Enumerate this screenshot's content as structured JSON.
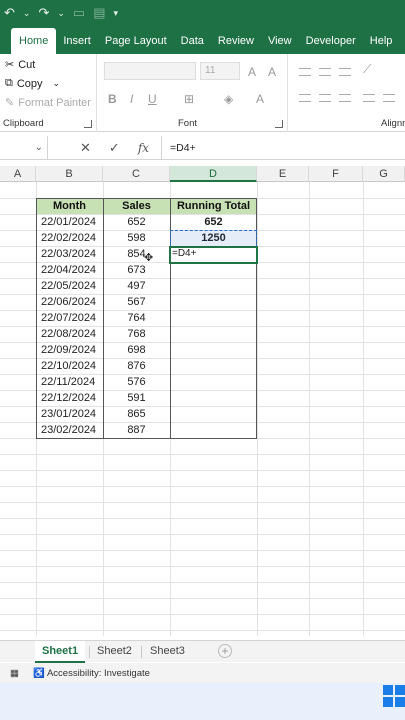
{
  "ribbon_tabs": [
    "Home",
    "Insert",
    "Page Layout",
    "Data",
    "Review",
    "View",
    "Developer",
    "Help"
  ],
  "clipboard": {
    "cut": "Cut",
    "copy": "Copy",
    "format_painter": "Format Painter",
    "label": "Clipboard"
  },
  "font": {
    "size": "11",
    "label": "Font"
  },
  "alignment": {
    "label": "Alignm"
  },
  "formula_bar": {
    "formula": "=D4+"
  },
  "columns": [
    "A",
    "B",
    "C",
    "D",
    "E",
    "F",
    "G"
  ],
  "table": {
    "headers": [
      "Month",
      "Sales",
      "Running Total"
    ],
    "rows": [
      [
        "22/01/2024",
        "652",
        "652"
      ],
      [
        "22/02/2024",
        "598",
        "1250"
      ],
      [
        "22/03/2024",
        "854",
        "=D4+"
      ],
      [
        "22/04/2024",
        "673",
        ""
      ],
      [
        "22/05/2024",
        "497",
        ""
      ],
      [
        "22/06/2024",
        "567",
        ""
      ],
      [
        "22/07/2024",
        "764",
        ""
      ],
      [
        "22/08/2024",
        "768",
        ""
      ],
      [
        "22/09/2024",
        "698",
        ""
      ],
      [
        "22/10/2024",
        "876",
        ""
      ],
      [
        "22/11/2024",
        "576",
        ""
      ],
      [
        "22/12/2024",
        "591",
        ""
      ],
      [
        "23/01/2024",
        "865",
        ""
      ],
      [
        "23/02/2024",
        "887",
        ""
      ]
    ]
  },
  "sheets": [
    "Sheet1",
    "Sheet2",
    "Sheet3"
  ],
  "status": {
    "accessibility": "Accessibility: Investigate"
  },
  "colors": {
    "accent": "#1e7145",
    "header_fill": "#c7e1b4",
    "selection": "#217346"
  }
}
